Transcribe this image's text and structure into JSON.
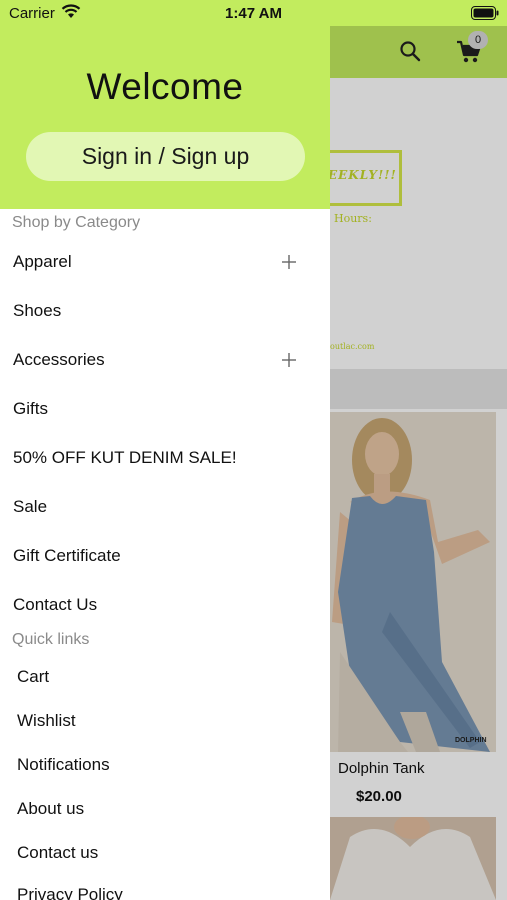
{
  "status_bar": {
    "carrier": "Carrier",
    "time": "1:47 AM"
  },
  "topbar": {
    "cart_count": "0",
    "icons": [
      "search-icon",
      "cart-icon"
    ]
  },
  "banner": {
    "headline": "EEKLY!!!",
    "hours": "Hours:",
    "url": "outlac.com"
  },
  "product": {
    "brand": "DOLPHIN",
    "name": "Dolphin Tank",
    "price": "$20.00"
  },
  "drawer": {
    "welcome": "Welcome",
    "signin_label": "Sign in / Sign up",
    "shop_title": "Shop by Category",
    "categories": [
      {
        "label": "Apparel",
        "expandable": true
      },
      {
        "label": "Shoes",
        "expandable": false
      },
      {
        "label": "Accessories",
        "expandable": true
      },
      {
        "label": "Gifts",
        "expandable": false
      },
      {
        "label": "50% OFF KUT DENIM SALE!",
        "expandable": false
      },
      {
        "label": "Sale",
        "expandable": false
      },
      {
        "label": "Gift Certificate",
        "expandable": false
      },
      {
        "label": "Contact Us",
        "expandable": false
      }
    ],
    "quick_title": "Quick links",
    "quick_links": [
      {
        "label": "Cart"
      },
      {
        "label": "Wishlist"
      },
      {
        "label": "Notifications"
      },
      {
        "label": "About us"
      },
      {
        "label": "Contact us"
      },
      {
        "label": "Privacy Policy"
      }
    ]
  },
  "colors": {
    "accent": "#c2ec5e",
    "button_fill": "#e2f7b4",
    "section_text": "#8a8a8a"
  }
}
